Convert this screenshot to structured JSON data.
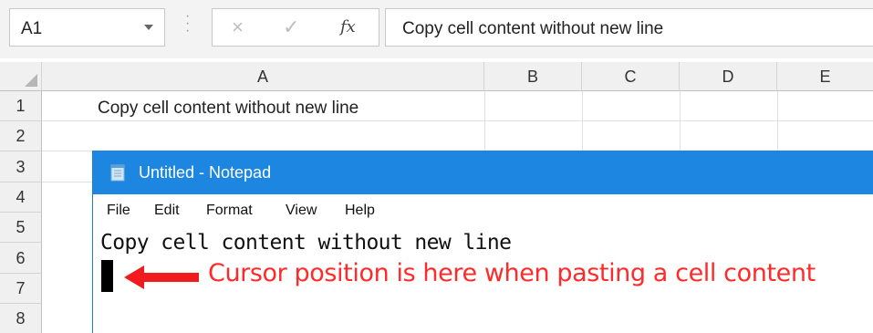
{
  "excel": {
    "name_box": "A1",
    "formula_bar": {
      "cancel_icon": "×",
      "enter_icon": "✓",
      "fx_label": "fx",
      "content": "Copy cell content without new line"
    },
    "columns": [
      "A",
      "B",
      "C",
      "D",
      "E"
    ],
    "rows": [
      "1",
      "2",
      "3",
      "4",
      "5",
      "6",
      "7",
      "8"
    ],
    "cells": {
      "A1": "Copy cell content without new line"
    }
  },
  "notepad": {
    "icon": "notepad-icon",
    "title": "Untitled - Notepad",
    "menu": [
      "File",
      "Edit",
      "Format",
      "View",
      "Help"
    ],
    "content": "Copy cell content without new line"
  },
  "annotation": {
    "text": "Cursor position is here when pasting a cell content",
    "color": "#ff2a2a"
  },
  "colors": {
    "notepad_titlebar": "#1d86e0",
    "excel_header_bg": "#f0f0f0"
  }
}
